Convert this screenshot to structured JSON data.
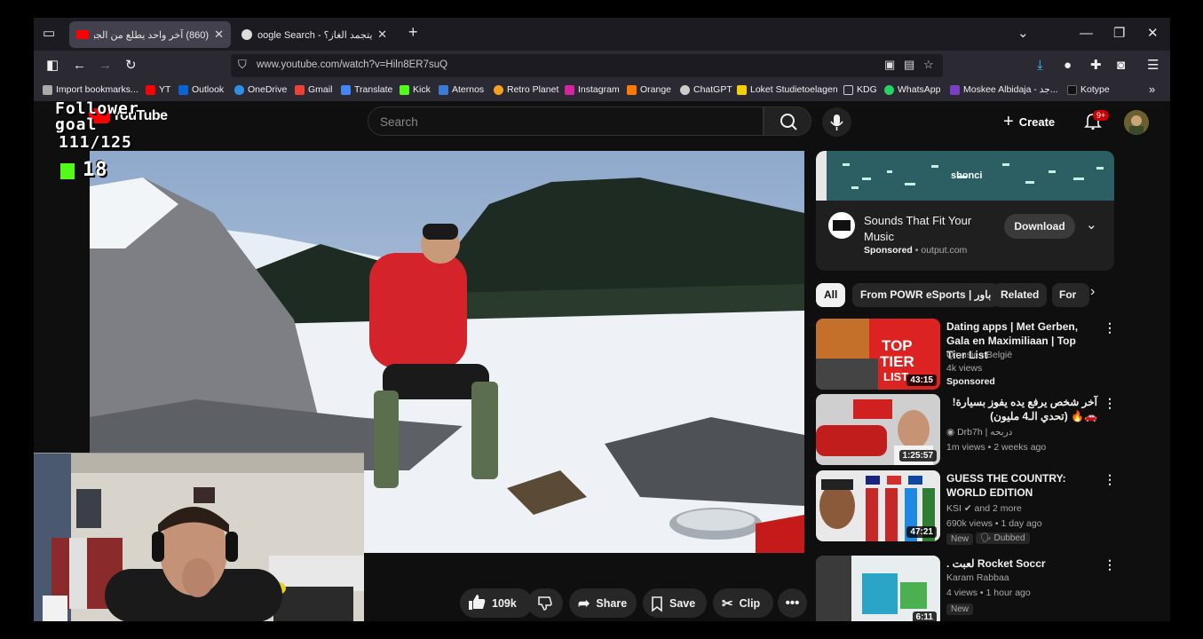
{
  "browser": {
    "tabs": [
      {
        "title": "(860) آخر واحد يطلع من الجبل ال",
        "active": true
      },
      {
        "title": "oogle Search - هل يتجمد الغاز؟",
        "active": false
      }
    ],
    "url": "www.youtube.com/watch?v=Hiln8ER7suQ",
    "bookmarks": [
      "Import bookmarks...",
      "YT",
      "Outlook",
      "OneDrive",
      "Gmail",
      "Translate",
      "Kick",
      "Aternos",
      "Retro Planet",
      "Instagram",
      "Orange",
      "ChatGPT",
      "Loket Studietoelagen",
      "KDG",
      "WhatsApp",
      "Moskee Albidaja - جد...",
      "Kotype"
    ]
  },
  "youtube": {
    "logo_text": "YouTube",
    "search_placeholder": "Search",
    "create_label": "Create",
    "notif_count": "9+"
  },
  "overlay": {
    "follower_line1": "Follower",
    "follower_line2": "goal",
    "follower_count": "111/125",
    "kick_count": "18"
  },
  "actions": {
    "likes": "109k",
    "share": "Share",
    "save": "Save",
    "clip": "Clip"
  },
  "ad": {
    "banner_text": "shonci",
    "title": "Sounds That Fit Your Music",
    "sponsored": "Sponsored",
    "domain": "output.com",
    "download": "Download"
  },
  "chips": [
    "All",
    "From POWR eSports | باور",
    "Related",
    "For"
  ],
  "recommendations": [
    {
      "title": "Dating apps | Met Gerben, Gala en Maximiliaan | Top Tier List",
      "channel": "Qmusic - België",
      "meta": "4k views",
      "badge": "Sponsored",
      "duration": "43:15"
    },
    {
      "title": "آخر شخص يرفع يده يفوز بسيارة! 🚗🔥 (تحدي الـ4 مليون)",
      "channel": "Drb7h | دربحه",
      "meta": "1m views • 2 weeks ago",
      "badge": "",
      "duration": "1:25:57"
    },
    {
      "title": "GUESS THE COUNTRY: WORLD EDITION",
      "channel": "KSI ✔ and 2 more",
      "meta": "690k views • 1 day ago",
      "badge": "New",
      "badge2": "Dubbed",
      "duration": "47:21"
    },
    {
      "title": "Rocket Soccr لعبت .",
      "channel": "Karam Rabbaa",
      "meta": "4 views • 1 hour ago",
      "badge": "New",
      "duration": "6:11"
    }
  ]
}
